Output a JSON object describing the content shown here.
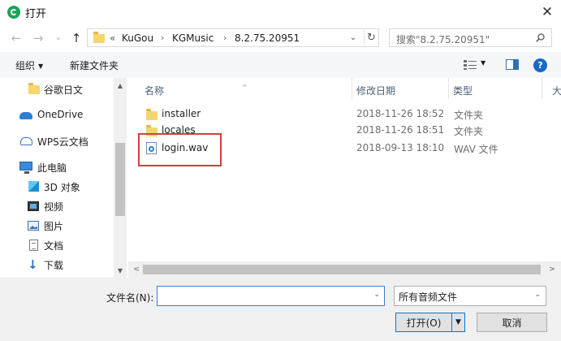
{
  "window": {
    "title": "打开",
    "close_glyph": "✕"
  },
  "nav": {
    "back_glyph": "←",
    "forward_glyph": "→",
    "recent_glyph": "⌄",
    "up_glyph": "↑",
    "address": {
      "overflow": "«",
      "crumbs": [
        "KuGou",
        "KGMusic",
        "8.2.75.20951"
      ],
      "sep": "›",
      "dropdown_glyph": "⌄",
      "refresh_glyph": "↻"
    },
    "search_placeholder": "搜索\"8.2.75.20951\""
  },
  "toolbar": {
    "organize": "组织",
    "organize_caret": "▼",
    "new_folder": "新建文件夹",
    "view_caret": "▼",
    "help": "?"
  },
  "sidebar": {
    "items": [
      {
        "label": "谷歌日文",
        "icon": "folder-icon"
      },
      {
        "label": "OneDrive",
        "icon": "onedrive-icon"
      },
      {
        "label": "WPS云文档",
        "icon": "cloud-icon"
      },
      {
        "label": "此电脑",
        "icon": "pc-icon"
      },
      {
        "label": "3D 对象",
        "icon": "cube-icon"
      },
      {
        "label": "视频",
        "icon": "video-icon"
      },
      {
        "label": "图片",
        "icon": "pic-icon"
      },
      {
        "label": "文档",
        "icon": "doc-icon"
      },
      {
        "label": "下载",
        "icon": "download-icon"
      }
    ],
    "scroll_up": "▲",
    "scroll_down": "▼"
  },
  "columns": {
    "name": "名称",
    "modified": "修改日期",
    "type": "类型",
    "size": "大",
    "sort_glyph": "^"
  },
  "files": [
    {
      "name": "installer",
      "modified": "2018-11-26 18:52",
      "type": "文件夹",
      "icon": "folder-icon"
    },
    {
      "name": "locales",
      "modified": "2018-11-26 18:51",
      "type": "文件夹",
      "icon": "folder-icon"
    },
    {
      "name": "login.wav",
      "modified": "2018-09-13 18:10",
      "type": "WAV 文件",
      "icon": "wav-file-icon"
    }
  ],
  "hscroll": {
    "left": "<",
    "right": ">"
  },
  "bottom": {
    "filename_label": "文件名(N):",
    "filename_value": "",
    "filename_caret": "⌄",
    "filetype_value": "所有音频文件",
    "filetype_caret": "⌄",
    "open_label": "打开(O)",
    "open_split": "▼",
    "cancel_label": "取消"
  },
  "colors": {
    "accent": "#0078d7",
    "highlight_box": "#d23f3f",
    "folder": "#f6d470"
  }
}
